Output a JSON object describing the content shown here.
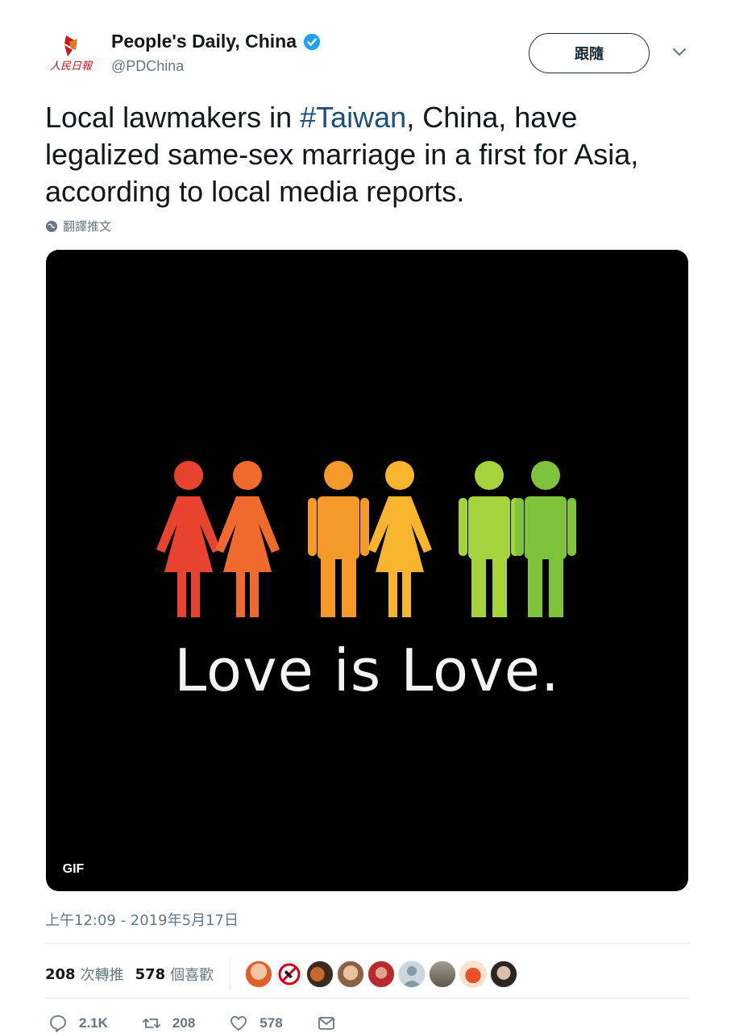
{
  "header": {
    "display_name": "People's Daily, China",
    "handle": "@PDChina",
    "follow_label": "跟隨"
  },
  "tweet": {
    "text_before": "Local lawmakers in ",
    "hashtag": "#Taiwan",
    "text_after": ", China, have legalized same-sex marriage in a first for Asia, according to local media reports.",
    "translate_label": "翻譯推文"
  },
  "media": {
    "caption": "Love is Love.",
    "badge": "GIF",
    "figure_colors": [
      "#e8432f",
      "#ef6a2c",
      "#f49a2a",
      "#f7b52d",
      "#a6d33b",
      "#7ec33a"
    ]
  },
  "timestamp": "上午12:09 - 2019年5月17日",
  "stats": {
    "retweets_count": "208",
    "retweets_label": "次轉推",
    "likes_count": "578",
    "likes_label": "個喜歡"
  },
  "actions": {
    "reply_count": "2.1K",
    "retweet_count": "208",
    "like_count": "578"
  },
  "colors": {
    "link": "#1b4f7a",
    "verified": "#1da1f2",
    "muted": "#657786"
  }
}
